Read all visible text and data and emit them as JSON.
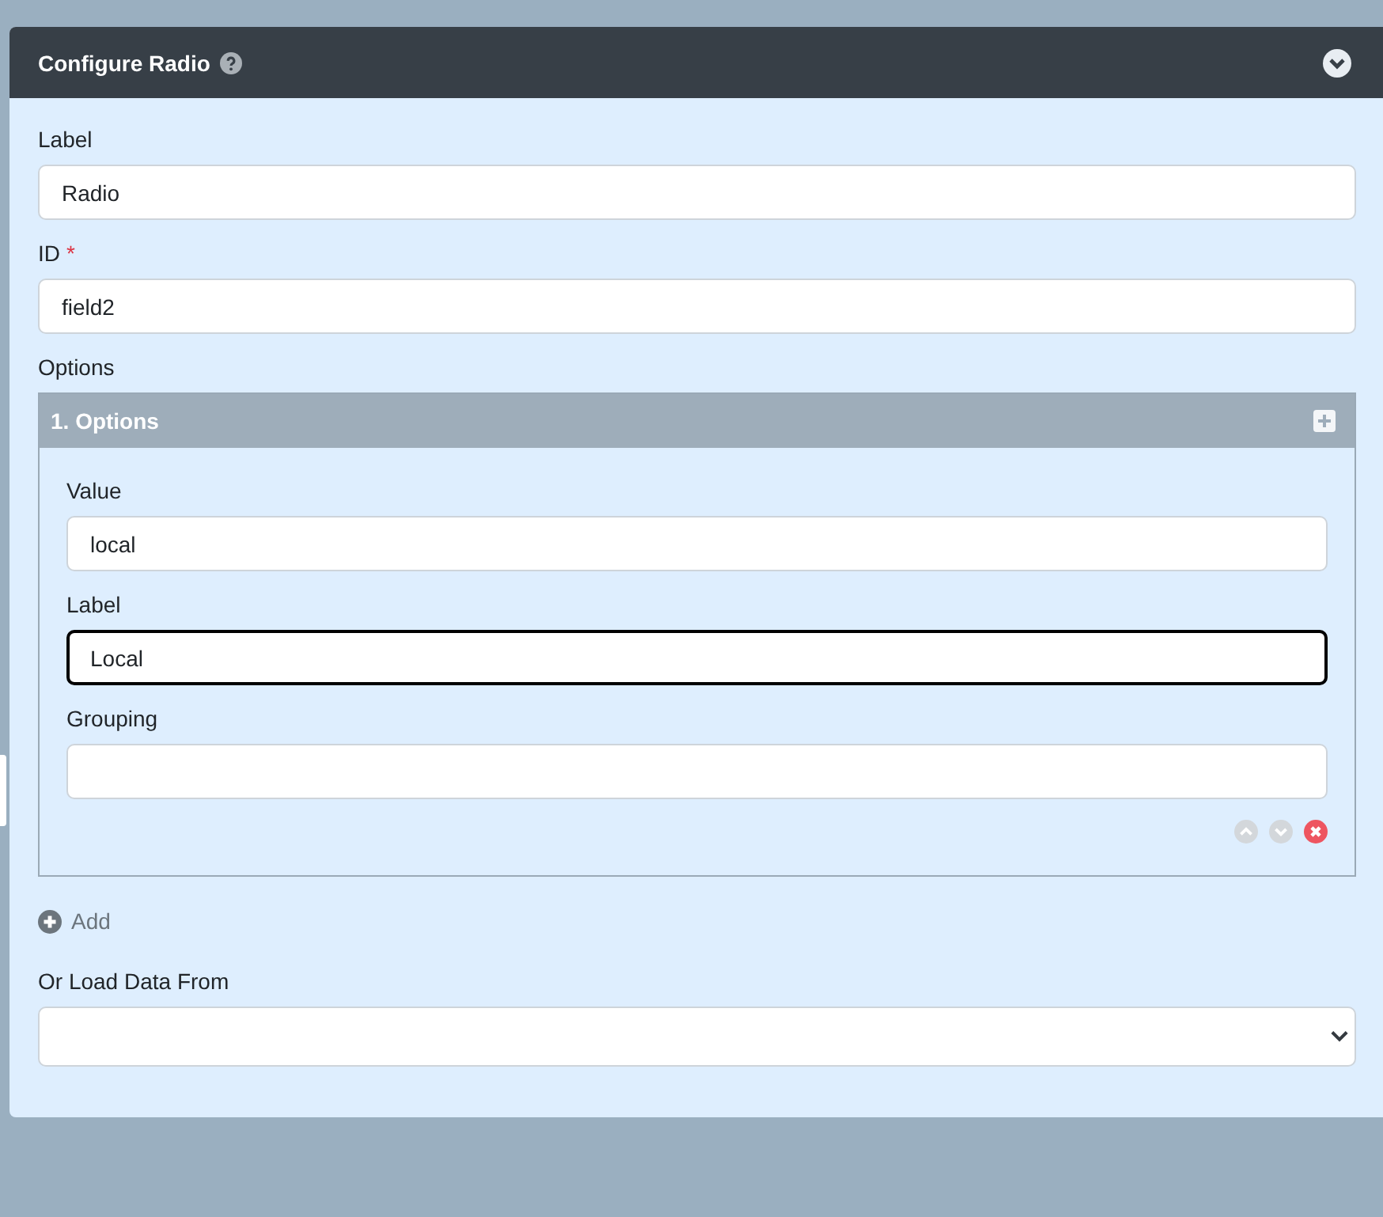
{
  "panel": {
    "title": "Configure Radio",
    "expanded": true
  },
  "fields": [
    {
      "label": "Label",
      "value": "Radio"
    },
    {
      "label": "ID",
      "required_mark": "*",
      "value": "field2"
    }
  ],
  "options": {
    "label": "Options",
    "items": [
      {
        "title": "1. Options",
        "fields": [
          {
            "label": "Value",
            "value": "local",
            "focused": false
          },
          {
            "label": "Label",
            "value": "Local",
            "focused": true
          },
          {
            "label": "Grouping",
            "focused": false
          }
        ],
        "move_up_disabled": true,
        "move_down_disabled": true
      }
    ],
    "add_label": "Add"
  },
  "load": {
    "label": "Or Load Data From"
  }
}
